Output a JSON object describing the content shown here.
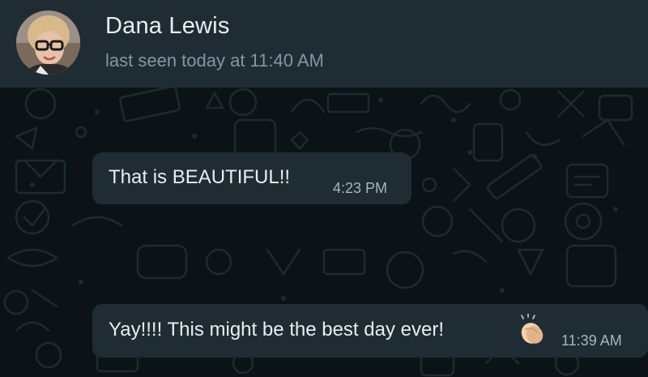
{
  "header": {
    "contact_name": "Dana Lewis",
    "status": "last seen today at 11:40 AM",
    "avatar_icon": "contact-avatar"
  },
  "messages": [
    {
      "text": "That is BEAUTIFUL!!",
      "time": "4:23 PM"
    },
    {
      "text": "Yay!!!! This might be the best day ever!",
      "emoji_icon": "clapping-hands-icon",
      "time": "11:39 AM"
    }
  ],
  "colors": {
    "header_bg": "#1f2c34",
    "chat_bg": "#0c1317",
    "bubble_bg": "#202c33",
    "primary_text": "#e9edef",
    "secondary_text": "#8696a0"
  }
}
